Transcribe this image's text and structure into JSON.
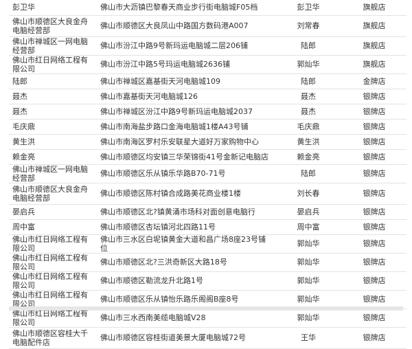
{
  "dealers": [
    {
      "name": "彭卫华",
      "address": "佛山市大沥镇巴黎春天商业步行街电脑城F05档",
      "person": "彭卫华",
      "level": "旗舰店"
    },
    {
      "name": "佛山市顺德区大良金舟电脑经营部",
      "address": "佛山市顺德区大良凤山中路国方数码港A007",
      "person": "刘常春",
      "level": "旗舰店"
    },
    {
      "name": "佛山市禅城区一网电脑经营部",
      "address": "佛山市汾江中路9号新玛运电脑城二层206铺",
      "person": "陆郎",
      "level": "旗舰店"
    },
    {
      "name": "佛山市红日网络工程有限公司",
      "address": "佛山市汾江中路5号玛运电脑城2636铺",
      "person": "郭灿华",
      "level": "旗舰店"
    },
    {
      "name": "陆郎",
      "address": "佛山市禅城区嘉基街天河电脑城109",
      "person": "陆郎",
      "level": "金牌店"
    },
    {
      "name": "聂杰",
      "address": "佛山市嘉基街天河电脑城126",
      "person": "聂杰",
      "level": "银牌店"
    },
    {
      "name": "聂杰",
      "address": "佛山市禅城区汾江中路9号新玛运电脑城2037",
      "person": "聂杰",
      "level": "银牌店"
    },
    {
      "name": "毛庆鼎",
      "address": "佛山市南海盐步路口金海电脑城1楼A43号铺",
      "person": "毛庆鼎",
      "level": "银牌店"
    },
    {
      "name": "黄生洪",
      "address": "佛山市南海区罗村乐安联星大道好万家购物中心",
      "person": "黄生洪",
      "level": "银牌店"
    },
    {
      "name": "赖金亮",
      "address": "佛山市顺德区均安镇三华荣锦街41号金新记电脑店",
      "person": "赖金亮",
      "level": "银牌店"
    },
    {
      "name": "佛山市禅城区一网电脑经营部",
      "address": "佛山市顺德区乐从镇乐华路B70-71号",
      "person": "陆郎",
      "level": "银牌店"
    },
    {
      "name": "佛山市顺德区大良金舟电脑经营部",
      "address": "佛山市顺德区陈村镇合成路美花商业楼1楼",
      "person": "刘长春",
      "level": "银牌店"
    },
    {
      "name": "晏启兵",
      "address": "佛山市顺德区北?镇黄涌市场科对面创意电脑行",
      "person": "晏启兵",
      "level": "银牌店"
    },
    {
      "name": "周中富",
      "address": "佛山市顺德区杏坛镇河北四路11号",
      "person": "周中富",
      "level": "银牌店"
    },
    {
      "name": "佛山市红日网络工程有限公司",
      "address": "佛山市三水区白坭镇黄金大道和昌广场8座23号铺位",
      "person": "郭灿华",
      "level": "银牌店"
    },
    {
      "name": "佛山市红日网络工程有限公司",
      "address": "佛山市顺德区北?三洪奇新区大路18号",
      "person": "郭灿华",
      "level": "银牌店"
    },
    {
      "name": "佛山市红日网络工程有限公司",
      "address": "佛山市顺德区勒流龙升北路1号",
      "person": "郭灿华",
      "level": "银牌店"
    },
    {
      "name": "佛山市红日网络工程有限公司",
      "address": "佛山市顺德区乐从镇怡乐路乐阁阁B座8号",
      "person": "郭灿华",
      "level": "银牌店"
    },
    {
      "name": "佛山市红日网络工程有限公司",
      "address": "佛山市三水西南美缆电脑城V28",
      "person": "郭灿华",
      "level": "银牌店"
    },
    {
      "name": "佛山市顺德区容桂大千电脑配件店",
      "address": "佛山市顺德区容桂街道美景大厦电脑城72号",
      "person": "王华",
      "level": "银牌店"
    }
  ]
}
